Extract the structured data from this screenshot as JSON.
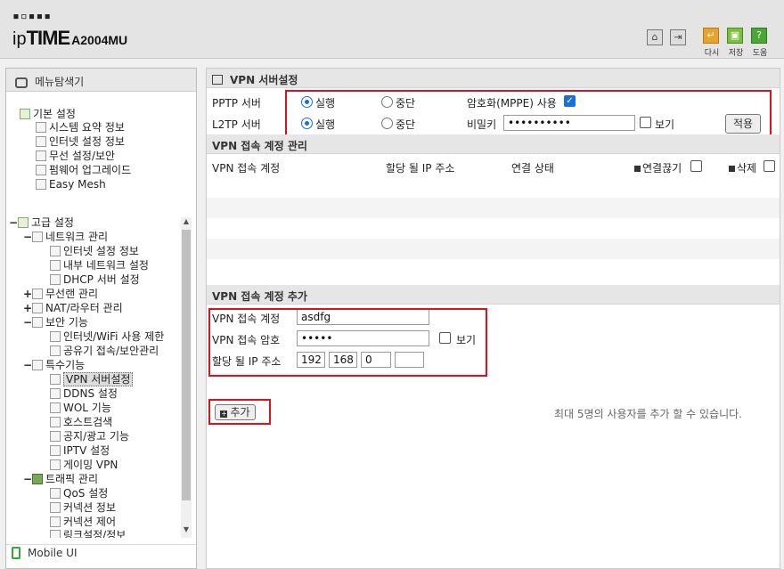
{
  "header": {
    "logo_dots": "▪▫▪▪▪",
    "logo_ip": "ip",
    "logo_time": "TIME",
    "model": "A2004MU",
    "buttons": [
      {
        "label": "다시"
      },
      {
        "label": "저장"
      },
      {
        "label": "도움"
      }
    ]
  },
  "sidebar": {
    "title": "메뉴탐색기",
    "basic": {
      "label": "기본 설정",
      "items": [
        "시스템 요약 정보",
        "인터넷 설정 정보",
        "무선 설정/보안",
        "펌웨어 업그레이드",
        "Easy Mesh"
      ]
    },
    "advanced": {
      "label": "고급 설정",
      "groups": [
        {
          "label": "네트워크 관리",
          "toggle": "−",
          "items": [
            "인터넷 설정 정보",
            "내부 네트워크 설정",
            "DHCP 서버 설정"
          ]
        },
        {
          "label": "무선랜 관리",
          "toggle": "+",
          "items": []
        },
        {
          "label": "NAT/라우터 관리",
          "toggle": "+",
          "items": []
        },
        {
          "label": "보안 기능",
          "toggle": "−",
          "items": [
            "인터넷/WiFi 사용 제한",
            "공유기 접속/보안관리"
          ]
        },
        {
          "label": "특수기능",
          "toggle": "−",
          "items": [
            "VPN 서버설정",
            "DDNS 설정",
            "WOL 기능",
            "호스트검색",
            "공지/광고 기능",
            "IPTV 설정",
            "게이밍 VPN"
          ]
        },
        {
          "label": "트래픽 관리",
          "toggle": "−",
          "items": [
            "QoS 설정",
            "커넥션 정보",
            "커넥션 제어",
            "링크설정/정보"
          ]
        }
      ]
    },
    "mobile": "Mobile UI"
  },
  "vpn_server": {
    "title": "VPN 서버설정",
    "pptp_label": "PPTP 서버",
    "l2tp_label": "L2TP 서버",
    "run": "실행",
    "stop": "중단",
    "mppe_label": "암호화(MPPE) 사용",
    "password_label": "비밀키",
    "password_value": "••••••••••",
    "show_label": "보기",
    "apply": "적용"
  },
  "accounts": {
    "title": "VPN 접속 계정 관리",
    "columns": [
      "VPN 접속 계정",
      "할당 될 IP 주소",
      "연결 상태",
      "연결끊기",
      "삭제"
    ]
  },
  "add_account": {
    "title": "VPN 접속 계정 추가",
    "account_label": "VPN 접속 계정",
    "account_value": "asdfg",
    "password_label": "VPN 접속 암호",
    "password_value": "•••••",
    "show_label": "보기",
    "ip_label": "할당 될 IP 주소",
    "ip": [
      "192",
      "168",
      "0",
      ""
    ],
    "add_button": "추가",
    "note": "최대 5명의 사용자를 추가 할 수 있습니다."
  }
}
